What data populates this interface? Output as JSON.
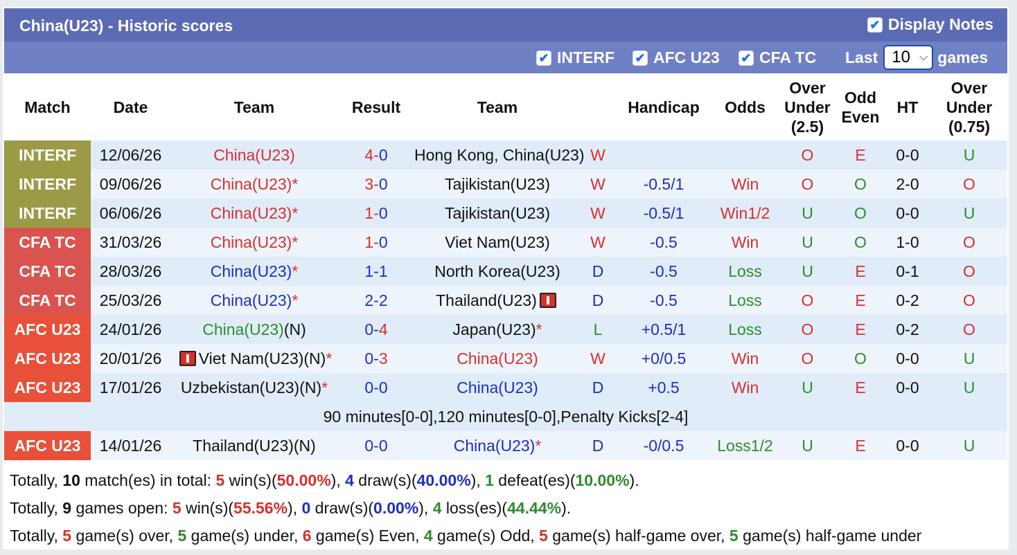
{
  "header": {
    "title": "China(U23) - Historic scores",
    "display_notes": "Display Notes"
  },
  "filters": {
    "interf": "INTERF",
    "afc": "AFC U23",
    "cfa": "CFA TC",
    "last": "Last",
    "last_value": "10",
    "games": "games"
  },
  "columns": {
    "match": "Match",
    "date": "Date",
    "team1": "Team",
    "result": "Result",
    "team2": "Team",
    "handicap": "Handicap",
    "odds": "Odds",
    "ou_line1": "Over",
    "ou_line2": "Under",
    "ou_line3": "(2.5)",
    "oe_line1": "Odd",
    "oe_line2": "Even",
    "ht": "HT",
    "ou2_line1": "Over",
    "ou2_line2": "Under",
    "ou2_line3": "(0.75)"
  },
  "league_colors": {
    "INTERF": "#9b9a47",
    "CFA TC": "#d9534f",
    "AFC U23": "#e8503a"
  },
  "rows": [
    {
      "league": "INTERF",
      "date": "12/06/26",
      "team1": "China(U23)",
      "t1c": "red",
      "t1star": "",
      "t1card": false,
      "sh": "4",
      "sa": "0",
      "shc": "red",
      "sac": "blue",
      "team2": "Hong Kong, China(U23)",
      "t2c": "",
      "t2star": "",
      "t2card": false,
      "wl": "W",
      "wlc": "red",
      "hc": "",
      "odds": "",
      "oddsc": "",
      "ou": "O",
      "ouc": "red",
      "oe": "E",
      "oec": "red",
      "ht": "0-0",
      "ou2": "U",
      "ou2c": "green"
    },
    {
      "league": "INTERF",
      "date": "09/06/26",
      "team1": "China(U23)",
      "t1c": "red",
      "t1star": "*",
      "t1card": false,
      "sh": "3",
      "sa": "0",
      "shc": "red",
      "sac": "blue",
      "team2": "Tajikistan(U23)",
      "t2c": "",
      "t2star": "",
      "t2card": false,
      "wl": "W",
      "wlc": "red",
      "hc": "-0.5/1",
      "odds": "Win",
      "oddsc": "red",
      "ou": "O",
      "ouc": "red",
      "oe": "O",
      "oec": "green",
      "ht": "2-0",
      "ou2": "O",
      "ou2c": "red"
    },
    {
      "league": "INTERF",
      "date": "06/06/26",
      "team1": "China(U23)",
      "t1c": "red",
      "t1star": "*",
      "t1card": false,
      "sh": "1",
      "sa": "0",
      "shc": "red",
      "sac": "blue",
      "team2": "Tajikistan(U23)",
      "t2c": "",
      "t2star": "",
      "t2card": false,
      "wl": "W",
      "wlc": "red",
      "hc": "-0.5/1",
      "odds": "Win1/2",
      "oddsc": "red",
      "ou": "U",
      "ouc": "green",
      "oe": "O",
      "oec": "green",
      "ht": "0-0",
      "ou2": "U",
      "ou2c": "green"
    },
    {
      "league": "CFA TC",
      "date": "31/03/26",
      "team1": "China(U23)",
      "t1c": "red",
      "t1star": "*",
      "t1card": false,
      "sh": "1",
      "sa": "0",
      "shc": "red",
      "sac": "blue",
      "team2": "Viet Nam(U23)",
      "t2c": "",
      "t2star": "",
      "t2card": false,
      "wl": "W",
      "wlc": "red",
      "hc": "-0.5",
      "odds": "Win",
      "oddsc": "red",
      "ou": "U",
      "ouc": "green",
      "oe": "O",
      "oec": "green",
      "ht": "1-0",
      "ou2": "O",
      "ou2c": "red"
    },
    {
      "league": "CFA TC",
      "date": "28/03/26",
      "team1": "China(U23)",
      "t1c": "blue",
      "t1star": "*",
      "t1card": false,
      "sh": "1",
      "sa": "1",
      "shc": "blue",
      "sac": "blue",
      "team2": "North Korea(U23)",
      "t2c": "",
      "t2star": "",
      "t2card": false,
      "wl": "D",
      "wlc": "blue",
      "hc": "-0.5",
      "odds": "Loss",
      "oddsc": "green",
      "ou": "U",
      "ouc": "green",
      "oe": "E",
      "oec": "red",
      "ht": "0-1",
      "ou2": "O",
      "ou2c": "red"
    },
    {
      "league": "CFA TC",
      "date": "25/03/26",
      "team1": "China(U23)",
      "t1c": "blue",
      "t1star": "*",
      "t1card": false,
      "sh": "2",
      "sa": "2",
      "shc": "blue",
      "sac": "blue",
      "team2": "Thailand(U23)",
      "t2c": "",
      "t2star": "",
      "t2card": true,
      "wl": "D",
      "wlc": "blue",
      "hc": "-0.5",
      "odds": "Loss",
      "oddsc": "green",
      "ou": "O",
      "ouc": "red",
      "oe": "E",
      "oec": "red",
      "ht": "0-2",
      "ou2": "O",
      "ou2c": "red"
    },
    {
      "league": "AFC U23",
      "date": "24/01/26",
      "team1": "China(U23)",
      "t1c": "green",
      "t1suffix": "(N)",
      "t1star": "",
      "t1card": false,
      "sh": "0",
      "sa": "4",
      "shc": "blue",
      "sac": "red",
      "team2": "Japan(U23)",
      "t2c": "",
      "t2star": "*",
      "t2card": false,
      "wl": "L",
      "wlc": "green",
      "hc": "+0.5/1",
      "odds": "Loss",
      "oddsc": "green",
      "ou": "O",
      "ouc": "red",
      "oe": "E",
      "oec": "red",
      "ht": "0-2",
      "ou2": "O",
      "ou2c": "red"
    },
    {
      "league": "AFC U23",
      "date": "20/01/26",
      "team1": "Viet Nam(U23)(N)",
      "t1c": "",
      "t1star": "*",
      "t1card": true,
      "sh": "0",
      "sa": "3",
      "shc": "blue",
      "sac": "red",
      "team2": "China(U23)",
      "t2c": "red",
      "t2star": "",
      "t2card": false,
      "wl": "W",
      "wlc": "red",
      "hc": "+0/0.5",
      "odds": "Win",
      "oddsc": "red",
      "ou": "O",
      "ouc": "red",
      "oe": "O",
      "oec": "green",
      "ht": "0-0",
      "ou2": "U",
      "ou2c": "green"
    },
    {
      "league": "AFC U23",
      "date": "17/01/26",
      "team1": "Uzbekistan(U23)(N)",
      "t1c": "",
      "t1star": "*",
      "t1card": false,
      "sh": "0",
      "sa": "0",
      "shc": "blue",
      "sac": "blue",
      "team2": "China(U23)",
      "t2c": "blue",
      "t2star": "",
      "t2card": false,
      "wl": "D",
      "wlc": "blue",
      "hc": "+0.5",
      "odds": "Win",
      "oddsc": "red",
      "ou": "U",
      "ouc": "green",
      "oe": "E",
      "oec": "red",
      "ht": "0-0",
      "ou2": "U",
      "ou2c": "green"
    },
    {
      "note": "90 minutes[0-0],120 minutes[0-0],Penalty Kicks[2-4]"
    },
    {
      "league": "AFC U23",
      "date": "14/01/26",
      "team1": "Thailand(U23)(N)",
      "t1c": "",
      "t1star": "",
      "t1card": false,
      "sh": "0",
      "sa": "0",
      "shc": "blue",
      "sac": "blue",
      "team2": "China(U23)",
      "t2c": "blue",
      "t2star": "*",
      "t2card": false,
      "wl": "D",
      "wlc": "blue",
      "hc": "-0/0.5",
      "odds": "Loss1/2",
      "oddsc": "green",
      "ou": "U",
      "ouc": "green",
      "oe": "E",
      "oec": "red",
      "ht": "0-0",
      "ou2": "U",
      "ou2c": "green"
    }
  ],
  "summary": [
    [
      [
        "Totally, ",
        ""
      ],
      [
        "10",
        "b"
      ],
      [
        " match(es) in total: ",
        ""
      ],
      [
        "5",
        "rb"
      ],
      [
        " win(s)(",
        ""
      ],
      [
        "50.00%",
        "rb"
      ],
      [
        "), ",
        ""
      ],
      [
        "4",
        "bb"
      ],
      [
        " draw(s)(",
        ""
      ],
      [
        "40.00%",
        "bb"
      ],
      [
        "), ",
        ""
      ],
      [
        "1",
        "gb"
      ],
      [
        " defeat(es)(",
        ""
      ],
      [
        "10.00%",
        "gb"
      ],
      [
        ").",
        ""
      ]
    ],
    [
      [
        "Totally, ",
        ""
      ],
      [
        "9",
        "b"
      ],
      [
        " games open: ",
        ""
      ],
      [
        "5",
        "rb"
      ],
      [
        " win(s)(",
        ""
      ],
      [
        "55.56%",
        "rb"
      ],
      [
        "), ",
        ""
      ],
      [
        "0",
        "bb"
      ],
      [
        " draw(s)(",
        ""
      ],
      [
        "0.00%",
        "bb"
      ],
      [
        "), ",
        ""
      ],
      [
        "4",
        "gb"
      ],
      [
        " loss(es)(",
        ""
      ],
      [
        "44.44%",
        "gb"
      ],
      [
        ").",
        ""
      ]
    ],
    [
      [
        "Totally, ",
        ""
      ],
      [
        "5",
        "rb"
      ],
      [
        " game(s) over, ",
        ""
      ],
      [
        "5",
        "gb"
      ],
      [
        " game(s) under, ",
        ""
      ],
      [
        "6",
        "rb"
      ],
      [
        " game(s) Even, ",
        ""
      ],
      [
        "4",
        "gb"
      ],
      [
        " game(s) Odd, ",
        ""
      ],
      [
        "5",
        "rb"
      ],
      [
        " game(s) half-game over, ",
        ""
      ],
      [
        "5",
        "gb"
      ],
      [
        " game(s) half-game under",
        ""
      ]
    ]
  ]
}
